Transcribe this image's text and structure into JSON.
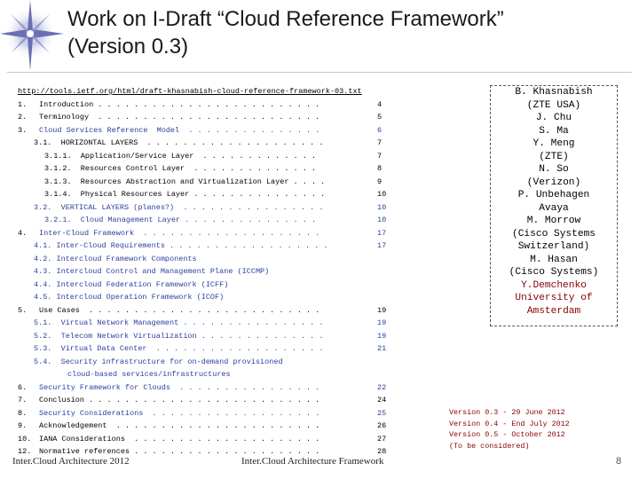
{
  "slide": {
    "title_line1": "Work on I-Draft “Cloud Reference Framework”",
    "title_line2": "(Version 0.3)",
    "url": "http://tools.ietf.org/html/draft-khasnabish-cloud-reference-framework-03.txt",
    "toc": [
      {
        "num": "1.",
        "indent": 0,
        "text": "Introduction . . . . . . . . . . . . . . . . . . . . . . . . .",
        "page": "4",
        "color": "black"
      },
      {
        "num": "2.",
        "indent": 0,
        "text": "Terminology  . . . . . . . . . . . . . . . . . . . . . . . . .",
        "page": "5",
        "color": "black"
      },
      {
        "num": "3.",
        "indent": 0,
        "text": "Cloud Services Reference  Model  . . . . . . . . . . . . . . .",
        "page": "6",
        "color": "blue"
      },
      {
        "num": "",
        "indent": 1,
        "text": "3.1.  HORIZONTAL LAYERS  . . . . . . . . . . . . . . . . . . . .",
        "page": "7",
        "color": "black"
      },
      {
        "num": "",
        "indent": 2,
        "text": "3.1.1.  Application/Service Layer  . . . . . . . . . . . . .",
        "page": "7",
        "color": "black"
      },
      {
        "num": "",
        "indent": 2,
        "text": "3.1.2.  Resources Control Layer  . . . . . . . . . . . . . .",
        "page": "8",
        "color": "black"
      },
      {
        "num": "",
        "indent": 2,
        "text": "3.1.3.  Resources Abstraction and Virtualization Layer . . . .",
        "page": "9",
        "color": "black"
      },
      {
        "num": "",
        "indent": 2,
        "text": "3.1.4.  Physical Resources Layer . . . . . . . . . . . . . . .",
        "page": "10",
        "color": "black"
      },
      {
        "num": "",
        "indent": 1,
        "text": "3.2.  VERTICAL LAYERS (planes?)  . . . . . . . . . . . . . . . .",
        "page": "10",
        "color": "blue"
      },
      {
        "num": "",
        "indent": 2,
        "text": "3.2.1.  Cloud Management Layer . . . . . . . . . . . . . . .",
        "page": "10",
        "color": "blue"
      },
      {
        "num": "4.",
        "indent": 0,
        "text": "Inter-Cloud Framework  . . . . . . . . . . . . . . . . . . . .",
        "page": "17",
        "color": "blue"
      },
      {
        "num": "",
        "indent": 1,
        "text": "4.1. Inter-Cloud Requirements . . . . . . . . . . . . . . . . . .",
        "page": "17",
        "color": "blue"
      },
      {
        "num": "",
        "indent": 1,
        "text": "4.2. Intercloud Framework Components",
        "page": "",
        "color": "blue"
      },
      {
        "num": "",
        "indent": 1,
        "text": "4.3. Intercloud Control and Management Plane (ICCMP)",
        "page": "",
        "color": "blue"
      },
      {
        "num": "",
        "indent": 1,
        "text": "4.4. Intercloud Federation Framework (ICFF)",
        "page": "",
        "color": "blue"
      },
      {
        "num": "",
        "indent": 1,
        "text": "4.5. Intercloud Operation Framework (ICOF)",
        "page": "",
        "color": "blue"
      },
      {
        "num": "5.",
        "indent": 0,
        "text": "Use Cases  . . . . . . . . . . . . . . . . . . . . . . . . . .",
        "page": "19",
        "color": "black"
      },
      {
        "num": "",
        "indent": 1,
        "text": "5.1.  Virtual Network Management . . . . . . . . . . . . . . . .",
        "page": "19",
        "color": "blue"
      },
      {
        "num": "",
        "indent": 1,
        "text": "5.2.  Telecom Network Virtualization . . . . . . . . . . . . . .",
        "page": "19",
        "color": "blue"
      },
      {
        "num": "",
        "indent": 1,
        "text": "5.3.  Virtual Data Center  . . . . . . . . . . . . . . . . . . .",
        "page": "21",
        "color": "blue"
      },
      {
        "num": "",
        "indent": 1,
        "text": "5.4.  Security infrastructure for on-demand provisioned",
        "page": "",
        "color": "blue"
      },
      {
        "num": "",
        "indent": 3,
        "text": "cloud-based services/infrastructures",
        "page": "",
        "color": "blue"
      },
      {
        "num": "6.",
        "indent": 0,
        "text": "Security Framework for Clouds  . . . . . . . . . . . . . . . .",
        "page": "22",
        "color": "blue"
      },
      {
        "num": "7.",
        "indent": 0,
        "text": "Conclusion . . . . . . . . . . . . . . . . . . . . . . . . . .",
        "page": "24",
        "color": "black"
      },
      {
        "num": "8.",
        "indent": 0,
        "text": "Security Considerations  . . . . . . . . . . . . . . . . . . .",
        "page": "25",
        "color": "blue"
      },
      {
        "num": "9.",
        "indent": 0,
        "text": "Acknowledgement  . . . . . . . . . . . . . . . . . . . . . . .",
        "page": "26",
        "color": "black"
      },
      {
        "num": "10.",
        "indent": 0,
        "text": "IANA Considerations  . . . . . . . . . . . . . . . . . . . . .",
        "page": "27",
        "color": "black"
      },
      {
        "num": "12.",
        "indent": 0,
        "text": "Normative references . . . . . . . . . . . . . . . . . . . . .",
        "page": "28",
        "color": "black"
      }
    ],
    "authors": [
      {
        "text": "B. Khasnabish",
        "highlight": false
      },
      {
        "text": "(ZTE USA)",
        "highlight": false
      },
      {
        "text": "J. Chu",
        "highlight": false
      },
      {
        "text": "S. Ma",
        "highlight": false
      },
      {
        "text": "Y. Meng",
        "highlight": false
      },
      {
        "text": "(ZTE)",
        "highlight": false
      },
      {
        "text": "N. So",
        "highlight": false
      },
      {
        "text": "(Verizon)",
        "highlight": false
      },
      {
        "text": "P. Unbehagen",
        "highlight": false
      },
      {
        "text": "Avaya",
        "highlight": false
      },
      {
        "text": "M. Morrow",
        "highlight": false
      },
      {
        "text": "(Cisco Systems",
        "highlight": false
      },
      {
        "text": "Switzerland)",
        "highlight": false
      },
      {
        "text": "M. Hasan",
        "highlight": false
      },
      {
        "text": "(Cisco Systems)",
        "highlight": false
      },
      {
        "text": "Y.Demchenko",
        "highlight": true
      },
      {
        "text": "University of",
        "highlight": true
      },
      {
        "text": "Amsterdam",
        "highlight": true
      }
    ],
    "versions": [
      "Version 0.3 - 29 June 2012",
      "Version 0.4 - End July 2012",
      "Version 0.5 - October 2012",
      "(To be considered)"
    ],
    "footer_left": "Inter.Cloud Architecture 2012",
    "footer_center": "Inter.Cloud Architecture Framework",
    "page_number": "8",
    "colors": {
      "blue_text": "#2a3f9e",
      "author_highlight": "#8b0000",
      "version_text": "#8b0000"
    }
  }
}
